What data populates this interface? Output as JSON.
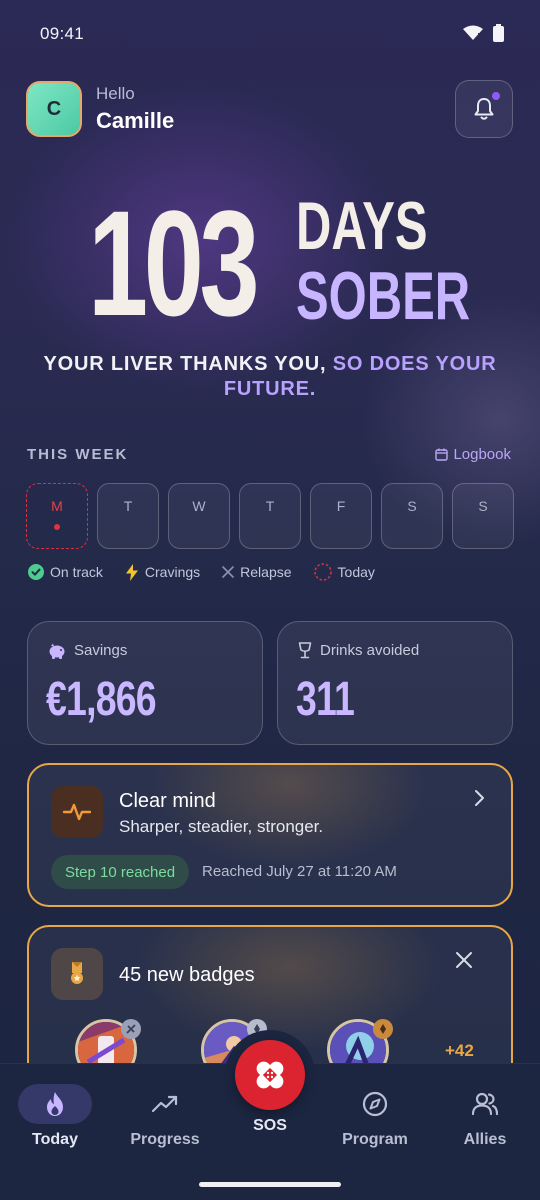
{
  "status_bar": {
    "time": "09:41"
  },
  "header": {
    "avatar_initial": "C",
    "greeting": "Hello",
    "user_name": "Camille"
  },
  "hero": {
    "count": "103",
    "unit_line1": "DAYS",
    "unit_line2": "SOBER",
    "tagline_part1": "YOUR LIVER THANKS YOU,",
    "tagline_part2": "SO DOES YOUR FUTURE."
  },
  "week": {
    "title": "THIS WEEK",
    "logbook_label": "Logbook",
    "days": [
      "M",
      "T",
      "W",
      "T",
      "F",
      "S",
      "S"
    ],
    "legend": {
      "on_track": "On track",
      "cravings": "Cravings",
      "relapse": "Relapse",
      "today": "Today"
    }
  },
  "stats": {
    "savings": {
      "label": "Savings",
      "value": "€1,866"
    },
    "drinks": {
      "label": "Drinks avoided",
      "value": "311"
    }
  },
  "milestone": {
    "title": "Clear mind",
    "subtitle": "Sharper, steadier, stronger.",
    "pill": "Step 10 reached",
    "date": "Reached July 27 at 11:20 AM"
  },
  "badges": {
    "title": "45 new badges",
    "more": "+42"
  },
  "nav": {
    "today": "Today",
    "progress": "Progress",
    "sos": "SOS",
    "program": "Program",
    "allies": "Allies"
  },
  "colors": {
    "accent_purple": "#c7b5ff",
    "milestone_border": "#e8a746",
    "sos_red": "#dc2430",
    "on_track_green": "#4ecb8f"
  }
}
